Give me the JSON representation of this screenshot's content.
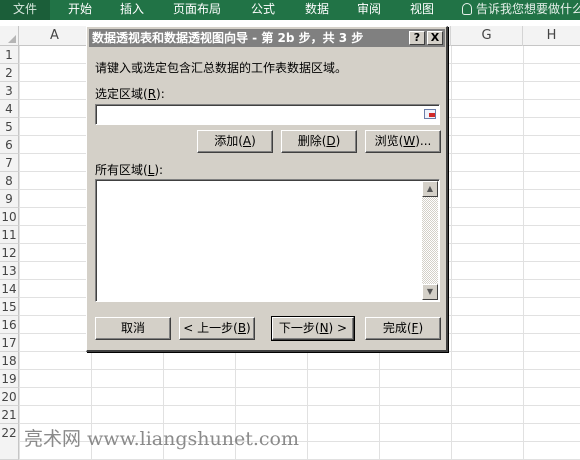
{
  "ribbon": {
    "tabs": [
      "文件",
      "开始",
      "插入",
      "页面布局",
      "公式",
      "数据",
      "审阅",
      "视图"
    ],
    "search_text": "告诉我您想要做什么"
  },
  "sheet": {
    "columns": [
      "A",
      "B",
      "C",
      "D",
      "E",
      "F",
      "G",
      "H"
    ],
    "rows": [
      "1",
      "2",
      "3",
      "4",
      "5",
      "6",
      "7",
      "8",
      "9",
      "10",
      "11",
      "12",
      "13",
      "14",
      "15",
      "16",
      "17",
      "18",
      "19",
      "20",
      "21",
      "22"
    ]
  },
  "dialog": {
    "title": "数据透视表和数据透视图向导 - 第 2b 步，共 3 步",
    "help_label": "?",
    "close_label": "X",
    "instruction": "请键入或选定包含汇总数据的工作表数据区域。",
    "range_label": "选定区域(",
    "range_label_key": "R",
    "range_label_end": "):",
    "range_value": "",
    "add_label": "添加(",
    "add_key": "A",
    "add_end": ")",
    "delete_label": "删除(",
    "delete_key": "D",
    "delete_end": ")",
    "browse_label": "浏览(",
    "browse_key": "W",
    "browse_end": ")...",
    "all_ranges_label": "所有区域(",
    "all_ranges_key": "L",
    "all_ranges_end": "):",
    "all_ranges_items": [],
    "cancel_label": "取消",
    "back_label": "< 上一步(",
    "back_key": "B",
    "back_end": ")",
    "next_label": "下一步(",
    "next_key": "N",
    "next_end": ") >",
    "finish_label": "完成(",
    "finish_key": "F",
    "finish_end": ")"
  },
  "watermark": "亮术网 www.liangshunet.com"
}
